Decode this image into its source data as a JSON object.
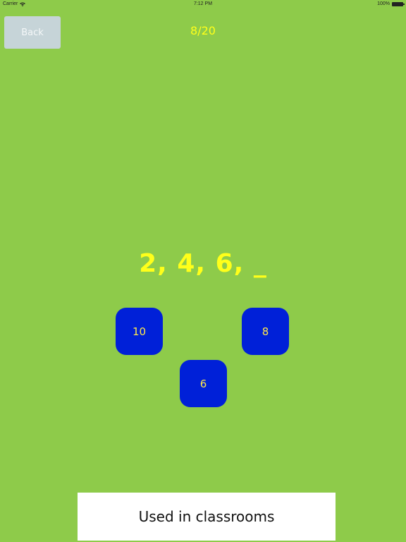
{
  "status_bar": {
    "carrier": "Carrier",
    "time": "7:12 PM",
    "battery": "100%"
  },
  "header": {
    "back_label": "Back",
    "progress": "8/20"
  },
  "question": {
    "sequence": "2, 4, 6, _"
  },
  "answers": [
    {
      "label": "10"
    },
    {
      "label": "8"
    },
    {
      "label": "6"
    }
  ],
  "banner": {
    "text": "Used in classrooms"
  },
  "colors": {
    "background": "#8ecb4a",
    "accent_text": "#ffff1a",
    "tile": "#0020d8",
    "tile_text": "#ffe84a"
  }
}
